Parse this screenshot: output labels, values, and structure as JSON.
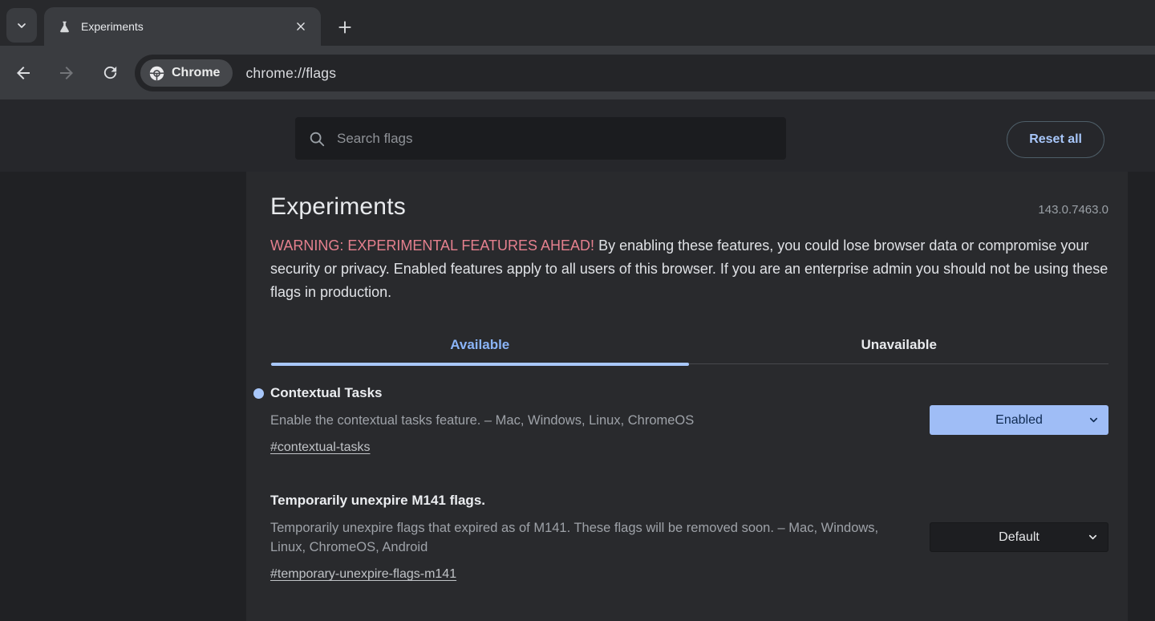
{
  "browser": {
    "tab_title": "Experiments",
    "site_chip_label": "Chrome",
    "url": "chrome://flags"
  },
  "header": {
    "search_placeholder": "Search flags",
    "reset_all_label": "Reset all"
  },
  "page": {
    "title": "Experiments",
    "version": "143.0.7463.0",
    "warning_highlight": "WARNING: EXPERIMENTAL FEATURES AHEAD!",
    "warning_body": "By enabling these features, you could lose browser data or compromise your security or privacy. Enabled features apply to all users of this browser. If you are an enterprise admin you should not be using these flags in production.",
    "tabs": [
      {
        "label": "Available",
        "active": true
      },
      {
        "label": "Unavailable",
        "active": false
      }
    ],
    "flags": [
      {
        "title": "Contextual Tasks",
        "modified_indicator": true,
        "description": "Enable the contextual tasks feature. – Mac, Windows, Linux, ChromeOS",
        "link": "#contextual-tasks",
        "value": "Enabled"
      },
      {
        "title": "Temporarily unexpire M141 flags.",
        "modified_indicator": false,
        "description": "Temporarily unexpire flags that expired as of M141. These flags will be removed soon. – Mac, Windows, Linux, ChromeOS, Android",
        "link": "#temporary-unexpire-flags-m141",
        "value": "Default"
      }
    ]
  },
  "colors": {
    "accent_blue": "#a8c7fa",
    "tab_active_blue": "#8ab4f8",
    "warning_red": "#e5808e",
    "enabled_select_bg": "#9fbdf6",
    "enabled_select_text": "#102c53",
    "panel_bg": "#292a2d",
    "gutter_bg": "#202124",
    "toolbar_bg": "#3a3c40"
  }
}
